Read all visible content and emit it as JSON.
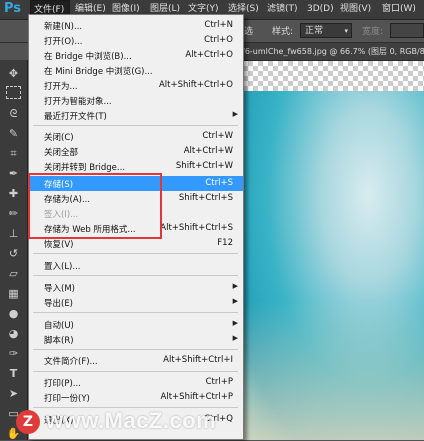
{
  "app": {
    "logo": "Ps"
  },
  "menubar": {
    "items": [
      {
        "label": "文件(F)"
      },
      {
        "label": "编辑(E)"
      },
      {
        "label": "图像(I)"
      },
      {
        "label": "图层(L)"
      },
      {
        "label": "文字(Y)"
      },
      {
        "label": "选择(S)"
      },
      {
        "label": "滤镜(T)"
      },
      {
        "label": "3D(D)"
      },
      {
        "label": "视图(V)"
      },
      {
        "label": "窗口(W)"
      }
    ]
  },
  "options": {
    "style_label": "样式:",
    "style_value": "正常",
    "width_label": "宽度:",
    "partial_label": "选"
  },
  "document": {
    "tab_title": "f6-umlChe_fw658.jpg @ 66.7% (图层 0, RGB/8)"
  },
  "file_menu": {
    "items": [
      {
        "label": "新建(N)...",
        "shortcut": "Ctrl+N"
      },
      {
        "label": "打开(O)...",
        "shortcut": "Ctrl+O"
      },
      {
        "label": "在 Bridge 中浏览(B)...",
        "shortcut": "Alt+Ctrl+O"
      },
      {
        "label": "在 Mini Bridge 中浏览(G)...",
        "shortcut": ""
      },
      {
        "label": "打开为...",
        "shortcut": "Alt+Shift+Ctrl+O"
      },
      {
        "label": "打开为智能对象...",
        "shortcut": ""
      },
      {
        "label": "最近打开文件(T)",
        "shortcut": ""
      },
      {
        "label": "关闭(C)",
        "shortcut": "Ctrl+W"
      },
      {
        "label": "关闭全部",
        "shortcut": "Alt+Ctrl+W"
      },
      {
        "label": "关闭并转到 Bridge...",
        "shortcut": "Shift+Ctrl+W"
      },
      {
        "label": "存储(S)",
        "shortcut": "Ctrl+S"
      },
      {
        "label": "存储为(A)...",
        "shortcut": "Shift+Ctrl+S"
      },
      {
        "label": "签入(I)...",
        "shortcut": ""
      },
      {
        "label": "存储为 Web 所用格式...",
        "shortcut": "Alt+Shift+Ctrl+S"
      },
      {
        "label": "恢复(V)",
        "shortcut": "F12"
      },
      {
        "label": "置入(L)...",
        "shortcut": ""
      },
      {
        "label": "导入(M)",
        "shortcut": ""
      },
      {
        "label": "导出(E)",
        "shortcut": ""
      },
      {
        "label": "自动(U)",
        "shortcut": ""
      },
      {
        "label": "脚本(R)",
        "shortcut": ""
      },
      {
        "label": "文件简介(F)...",
        "shortcut": "Alt+Shift+Ctrl+I"
      },
      {
        "label": "打印(P)...",
        "shortcut": "Ctrl+P"
      },
      {
        "label": "打印一份(Y)",
        "shortcut": "Alt+Shift+Ctrl+P"
      },
      {
        "label": "退出(X)",
        "shortcut": "Ctrl+Q"
      }
    ]
  },
  "watermark": {
    "logo_letter": "Z",
    "text": "www.MacZ.com"
  },
  "colors": {
    "highlight": "#3399ff",
    "annotation_box": "#e0373b"
  }
}
